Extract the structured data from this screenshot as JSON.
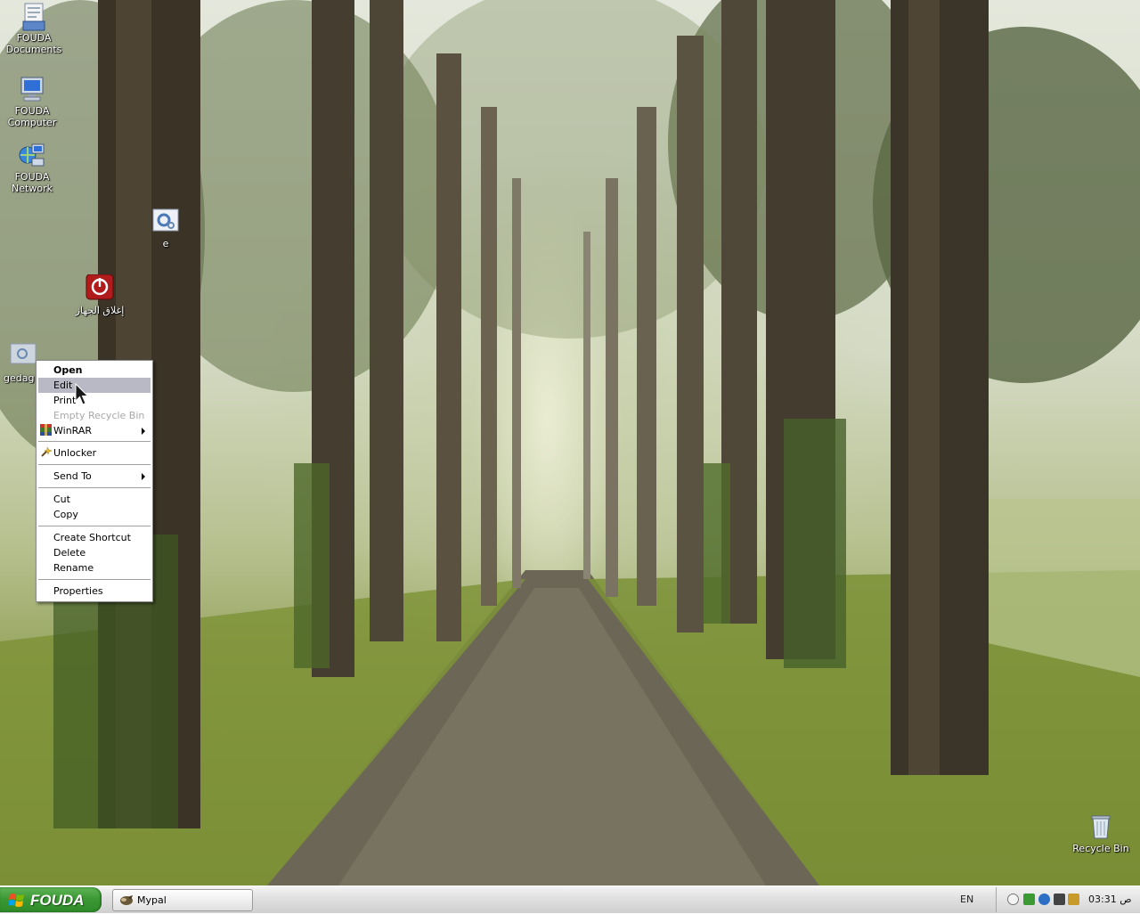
{
  "desktop": {
    "icons": [
      {
        "label": "FOUDA Documents",
        "line1": "FOUDA",
        "line2": "Documents",
        "icon": "documents-folder-icon"
      },
      {
        "label": "FOUDA Computer",
        "line1": "FOUDA",
        "line2": "Computer",
        "icon": "computer-icon"
      },
      {
        "label": "FOUDA Network",
        "line1": "FOUDA",
        "line2": "Network",
        "icon": "network-icon"
      },
      {
        "label": "e",
        "line1": "e",
        "line2": "",
        "icon": "settings-file-icon"
      },
      {
        "label": "إغلاق الجهاز",
        "line1": "إغلاق الجهاز",
        "line2": "",
        "icon": "power-icon"
      },
      {
        "label": "gedag",
        "line1": "gedag",
        "line2": "",
        "icon": "settings-file-icon"
      },
      {
        "label": "Recycle Bin",
        "line1": "Recycle Bin",
        "line2": "",
        "icon": "recycle-bin-icon"
      }
    ]
  },
  "context_menu": {
    "items": {
      "open": "Open",
      "edit": "Edit",
      "print": "Print",
      "empty_recycle_bin": "Empty Recycle Bin",
      "winrar": "WinRAR",
      "unlocker": "Unlocker",
      "send_to": "Send To",
      "cut": "Cut",
      "copy": "Copy",
      "create_shortcut": "Create Shortcut",
      "delete": "Delete",
      "rename": "Rename",
      "properties": "Properties"
    },
    "highlighted": "Edit",
    "disabled": [
      "Empty Recycle Bin"
    ]
  },
  "taskbar": {
    "start_label": "FOUDA",
    "task_button": "Mypal",
    "language": "EN",
    "clock": "03:31 ص"
  },
  "colors": {
    "start_green": "#3c9a35",
    "menu_highlight": "#b9b9c6",
    "taskbar": "#e2e2e2"
  }
}
